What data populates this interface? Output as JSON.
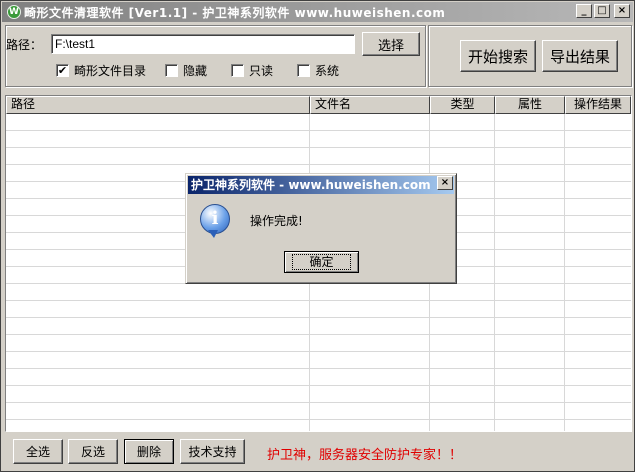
{
  "window": {
    "title": "畸形文件清理软件 [Ver1.1] - 护卫神系列软件 www.huweishen.com",
    "app_icon_letter": "W",
    "minimize": "_",
    "maximize": "□",
    "close": "×"
  },
  "toolbar": {
    "path_label": "路径：",
    "path_value": "F:\\test1",
    "select_label": "选择",
    "search_label": "开始搜索",
    "export_label": "导出结果",
    "checkboxes": [
      {
        "label": "畸形文件目录",
        "checked": true,
        "mark": "✔"
      },
      {
        "label": "隐藏",
        "checked": false,
        "mark": ""
      },
      {
        "label": "只读",
        "checked": false,
        "mark": ""
      },
      {
        "label": "系统",
        "checked": false,
        "mark": ""
      }
    ]
  },
  "table": {
    "columns": [
      "路径",
      "文件名",
      "类型",
      "属性",
      "操作结果"
    ]
  },
  "bottom": {
    "select_all": "全选",
    "invert": "反选",
    "delete": "删除",
    "support": "技术支持",
    "slogan": "护卫神，服务器安全防护专家！！"
  },
  "dialog": {
    "title": "护卫神系列软件 - www.huweishen.com",
    "message": "操作完成!",
    "ok": "确定",
    "close": "×",
    "icon_glyph": "i"
  },
  "colors": {
    "slogan": "#e00000",
    "dialog_title": "#0a246a"
  }
}
